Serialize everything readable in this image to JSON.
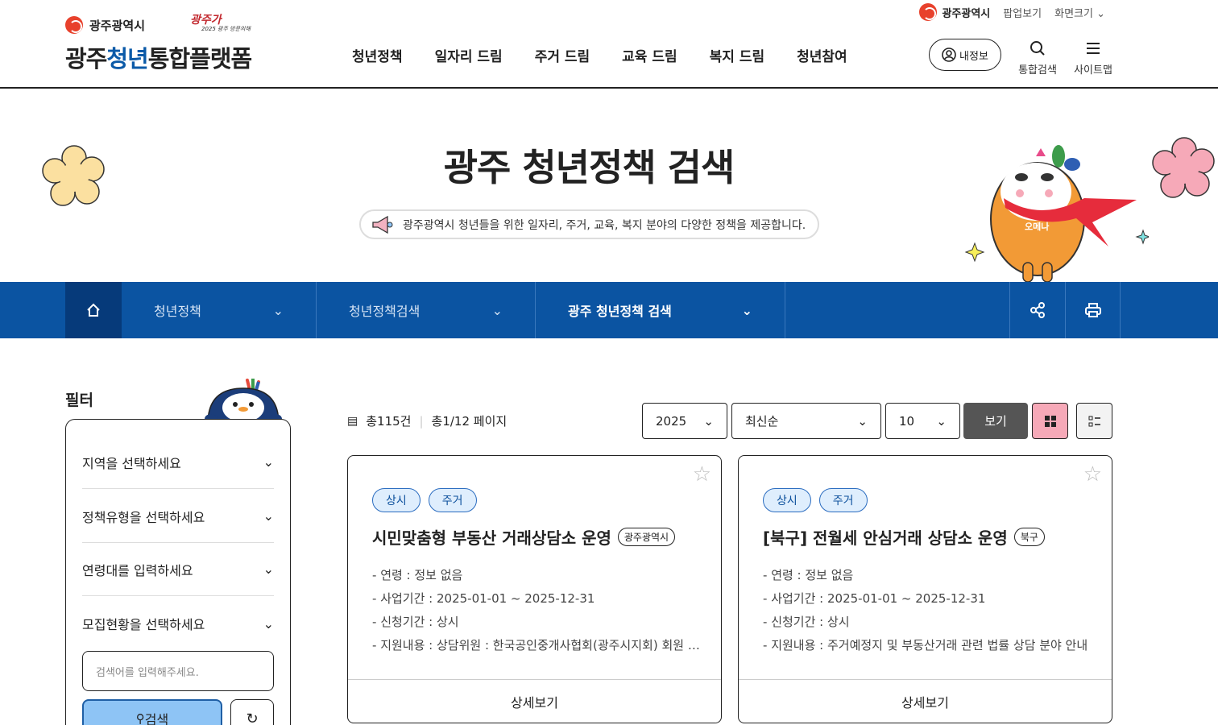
{
  "header": {
    "util": {
      "city": "광주광역시",
      "popup": "팝업보기",
      "font_size": "화면크기"
    },
    "brand_top": "광주광역시",
    "brand_slogan_1": "광주가",
    "brand_slogan_2": "2025 광주 방문의해",
    "brand_main_1": "광주",
    "brand_main_2": "청년",
    "brand_main_3": "통합플랫폼",
    "nav": [
      "청년정책",
      "일자리 드림",
      "주거 드림",
      "교육 드림",
      "복지 드림",
      "청년참여"
    ],
    "my_info": "내정보",
    "search": "통합검색",
    "sitemap": "사이트맵"
  },
  "hero": {
    "title": "광주 청년정책 검색",
    "desc": "광주광역시 청년들을 위한 일자리, 주거, 교육, 복지 분야의 다양한 정책을 제공합니다.",
    "mascot_label": "오메나"
  },
  "breadcrumb": {
    "items": [
      "청년정책",
      "청년정책검색",
      "광주 청년정책 검색"
    ]
  },
  "filter": {
    "title": "필터",
    "rows": [
      "지역을 선택하세요",
      "정책유형을 선택하세요",
      "연령대를 입력하세요",
      "모집현황을 선택하세요"
    ],
    "search_placeholder": "검색어를 입력해주세요.",
    "search_button": "검색"
  },
  "toolbar": {
    "total": "총115건",
    "pages": "총1/12 페이지",
    "year": "2025",
    "sort": "최신순",
    "per_page": "10",
    "view": "보기"
  },
  "cards": [
    {
      "tags": [
        "상시",
        "주거"
      ],
      "title": "시민맞춤형 부동산 거래상담소 운영",
      "region": "광주광역시",
      "info": [
        "연령 : 정보 없음",
        "사업기간 : 2025-01-01 ~ 2025-12-31",
        "신청기간 : 상시",
        "지원내용 : 상담위원 : 한국공인중개사협회(광주시지회) 회원 및 변호사"
      ],
      "detail": "상세보기"
    },
    {
      "tags": [
        "상시",
        "주거"
      ],
      "title": "[북구] 전월세 안심거래 상담소 운영",
      "region": "북구",
      "info": [
        "연령 : 정보 없음",
        "사업기간 : 2025-01-01 ~ 2025-12-31",
        "신청기간 : 상시",
        "지원내용 : 주거예정지 및 부동산거래 관련 법률 상담 분야 안내"
      ],
      "detail": "상세보기"
    }
  ]
}
